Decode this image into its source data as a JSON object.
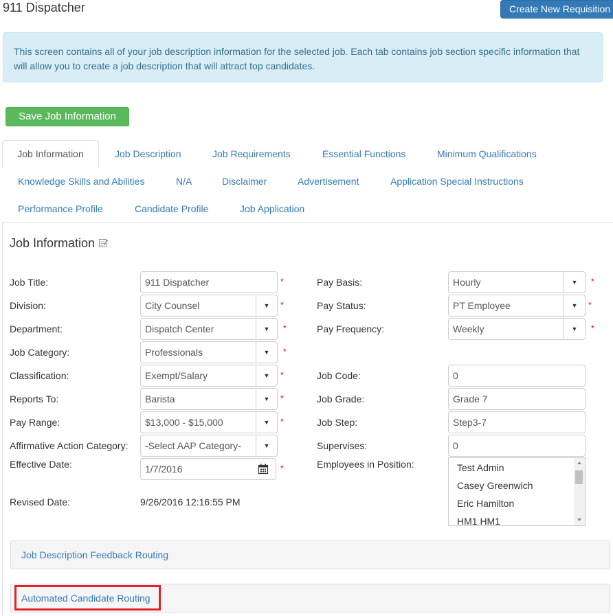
{
  "header": {
    "title": "911 Dispatcher",
    "create_button": "Create New Requisition"
  },
  "alert": {
    "text": "This screen contains all of your job description information for the selected job. Each tab contains job section specific information that will allow you to create a job description that will attract top candidates."
  },
  "save_button": "Save Job Information",
  "tabs": [
    "Job Information",
    "Job Description",
    "Job Requirements",
    "Essential Functions",
    "Minimum Qualifications",
    "Knowledge Skills and Abilities",
    "N/A",
    "Disclaimer",
    "Advertisement",
    "Application Special Instructions",
    "Performance Profile",
    "Candidate Profile",
    "Job Application"
  ],
  "active_tab": "Job Information",
  "section_title": "Job Information",
  "left_fields": [
    {
      "label": "Job Title:",
      "value": "911 Dispatcher"
    },
    {
      "label": "Division:",
      "value": "City Counsel"
    },
    {
      "label": "Department:",
      "value": "Dispatch Center"
    },
    {
      "label": "Job Category:",
      "value": "Professionals"
    },
    {
      "label": "Classification:",
      "value": "Exempt/Salary"
    },
    {
      "label": "Reports To:",
      "value": "Barista"
    },
    {
      "label": "Pay Range:",
      "value": "$13,000 - $15,000"
    },
    {
      "label": "Affirmative Action Category:",
      "value": "-Select AAP Category-"
    },
    {
      "label": "Effective Date:",
      "value": "1/7/2016"
    },
    {
      "label": "Revised Date:",
      "value": "9/26/2016 12:16:55 PM"
    }
  ],
  "right_fields": [
    {
      "label": "Pay Basis:",
      "value": "Hourly"
    },
    {
      "label": "Pay Status:",
      "value": "PT Employee"
    },
    {
      "label": "Pay Frequency:",
      "value": "Weekly"
    },
    {
      "label": "Job Code:",
      "value": "0"
    },
    {
      "label": "Job Grade:",
      "value": "Grade 7"
    },
    {
      "label": "Job Step:",
      "value": "Step3-7"
    },
    {
      "label": "Supervises:",
      "value": "0"
    },
    {
      "label": "Employees in Position:",
      "value": ""
    }
  ],
  "employees": [
    "Test Admin",
    "Casey Greenwich",
    "Eric Hamilton",
    "HM1 HM1"
  ],
  "required_marker": "*",
  "panels": {
    "feedback_routing": "Job Description Feedback Routing",
    "candidate_routing": "Automated Candidate Routing"
  },
  "colors": {
    "primary": "#337ab7",
    "success": "#5cb85c",
    "info_bg": "#d9edf7",
    "required": "#e00000",
    "highlight": "#e0232a"
  },
  "icons": {
    "edit": "edit-note-icon",
    "calendar": "calendar-icon",
    "dropdown": "chevron-down-icon"
  }
}
